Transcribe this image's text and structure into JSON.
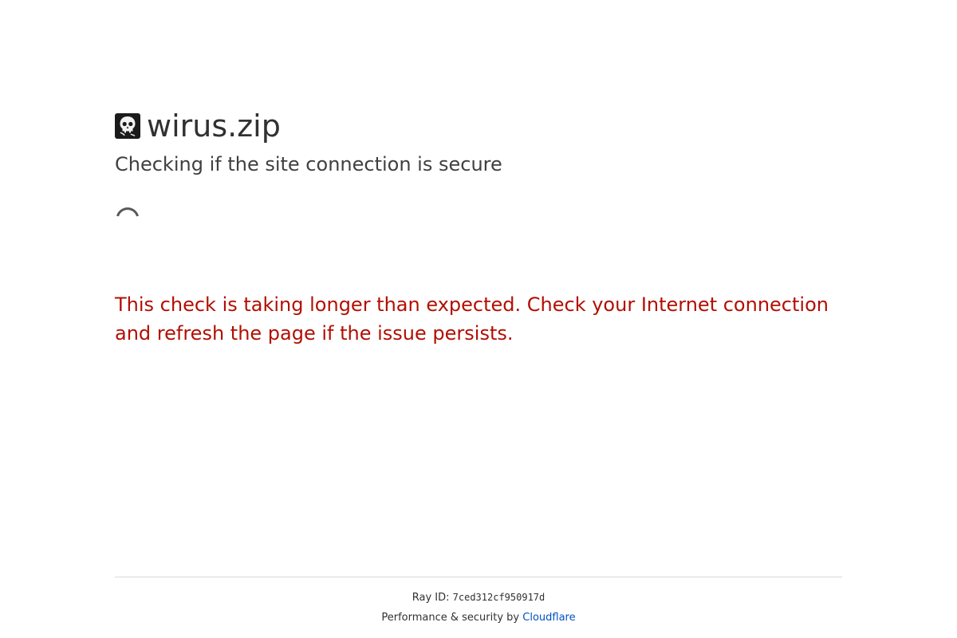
{
  "site": {
    "title": "wirus.zip",
    "favicon_icon": "skull-favicon-icon"
  },
  "status": {
    "subtitle": "Checking if the site connection is secure",
    "spinner_icon": "loading-spinner-icon",
    "warning": "This check is taking longer than expected. Check your Internet connection and refresh the page if the issue persists."
  },
  "footer": {
    "ray_label": "Ray ID:",
    "ray_id": "7ced312cf950917d",
    "perf_text": "Performance & security by",
    "provider_link": "Cloudflare"
  },
  "colors": {
    "warning_text": "#b20f03",
    "link": "#0051c3",
    "text": "#313131",
    "divider": "#d9d9d9"
  }
}
